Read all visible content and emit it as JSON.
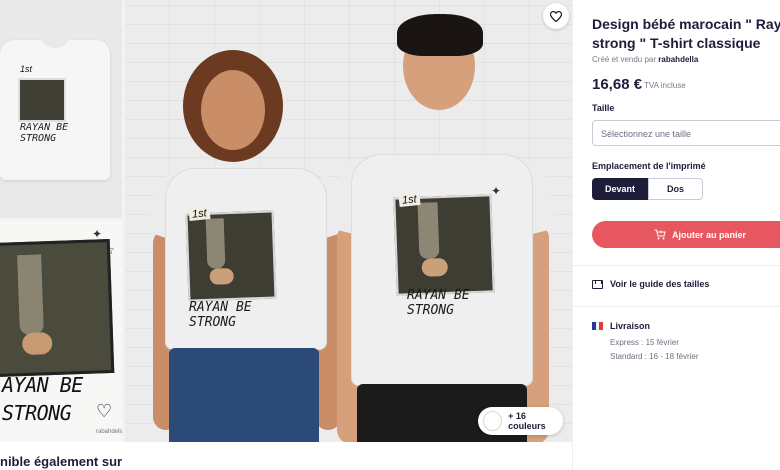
{
  "product": {
    "title_line1": "Design bébé marocain \" Rayan be",
    "title_line2": "strong \" T-shirt classique",
    "seller_prefix": "Créé et vendu par",
    "seller_name": "rabahdella",
    "price": "16,68 €",
    "tax_note": "TVA incluse"
  },
  "size": {
    "label": "Taille",
    "placeholder": "Sélectionnez une taille"
  },
  "print_location": {
    "label": "Emplacement de l'imprimé",
    "options": [
      "Devant",
      "Dos"
    ],
    "selected": "Devant"
  },
  "cart": {
    "button_label": "Ajouter au panier"
  },
  "size_guide": {
    "label": "Voir le guide des tailles"
  },
  "shipping": {
    "title": "Livraison",
    "express": "Express : 15 février",
    "standard": "Standard : 16 - 18 février"
  },
  "gallery": {
    "colors_label": "+ 16 couleurs",
    "print_text_line1": "RAYAN BE",
    "print_text_line2": "STRONG",
    "print_badge": "1st",
    "thumb_text_line1": "AYAN BE",
    "thumb_text_line2": "STRONG",
    "thumb_signature": "rabahdella"
  },
  "bottom_caption": "nible également sur",
  "colors": {
    "accent": "#e6575f",
    "navy": "#1d1d3a"
  },
  "icons": [
    "heart-icon",
    "cart-icon",
    "ruler-icon",
    "france-flag-icon"
  ]
}
